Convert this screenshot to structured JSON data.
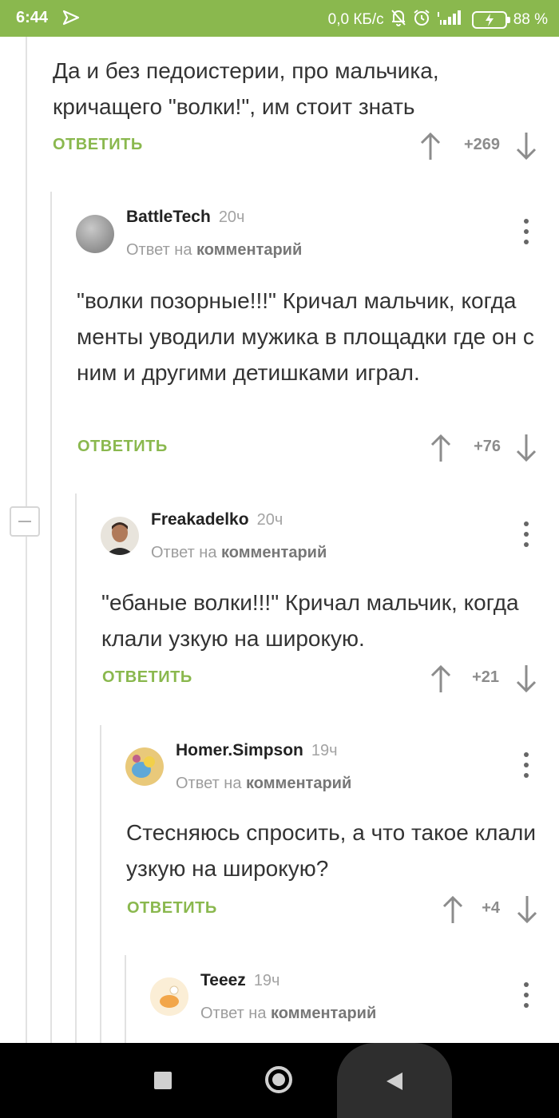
{
  "status_bar": {
    "time": "6:44",
    "network_speed": "0,0 КБ/с",
    "battery": "88 %",
    "icons": [
      "navigation-icon",
      "mute-icon",
      "alarm-icon",
      "signal-icon",
      "battery-icon"
    ]
  },
  "reply_label": "ОТВЕТИТЬ",
  "reply_to_prefix": "Ответ на",
  "reply_to_link": "комментарий",
  "comments": [
    {
      "text": "Да и без педоистерии, про мальчика, кричащего \"волки!\", им стоит знать",
      "votes": "+269"
    },
    {
      "author": "BattleTech",
      "time": "20ч",
      "text": "\"волки позорные!!!\" Кричал мальчик, когда менты уводили мужика в площадки где он с ним и другими детишками играл.",
      "votes": "+76"
    },
    {
      "author": "Freakadelko",
      "time": "20ч",
      "text": "\"ебаные волки!!!\" Кричал мальчик, когда клали узкую на широкую.",
      "votes": "+21"
    },
    {
      "author": "Homer.Simpson",
      "time": "19ч",
      "text": "Стесняюсь спросить, а что такое клали узкую на широкую?",
      "votes": "+4"
    },
    {
      "author": "Teeez",
      "time": "19ч"
    }
  ],
  "colors": {
    "accent": "#8ab84e",
    "status_bar": "#8ab84e",
    "vote_count": "#8c8c8c"
  }
}
